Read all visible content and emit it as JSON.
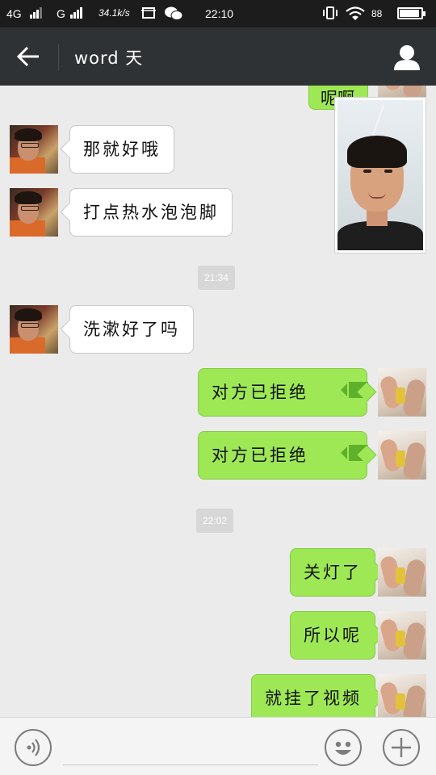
{
  "status_bar": {
    "network1": "4G",
    "network2": "G",
    "speed": "34.1k/s",
    "time": "22:10",
    "battery": "88"
  },
  "header": {
    "title": "word 天"
  },
  "top_partial_message": "呢啊",
  "messages": [
    {
      "side": "left",
      "text": "那就好哦"
    },
    {
      "side": "left",
      "text": "打点热水泡泡脚"
    },
    {
      "type": "timestamp",
      "text": "21:34"
    },
    {
      "side": "left",
      "text": "洗漱好了吗"
    },
    {
      "side": "right",
      "text": "对方已拒绝",
      "icon": "video-call-icon"
    },
    {
      "side": "right",
      "text": "对方已拒绝",
      "icon": "video-call-icon"
    },
    {
      "type": "timestamp",
      "text": "22:02"
    },
    {
      "side": "right",
      "text": "关灯了"
    },
    {
      "side": "right",
      "text": "所以呢"
    },
    {
      "side": "right",
      "text": "就挂了视频"
    }
  ],
  "colors": {
    "header_bg": "#2f3234",
    "chat_bg": "#ebebeb",
    "sent_bubble": "#9ee855",
    "received_bubble": "#ffffff"
  },
  "input": {
    "placeholder": ""
  }
}
